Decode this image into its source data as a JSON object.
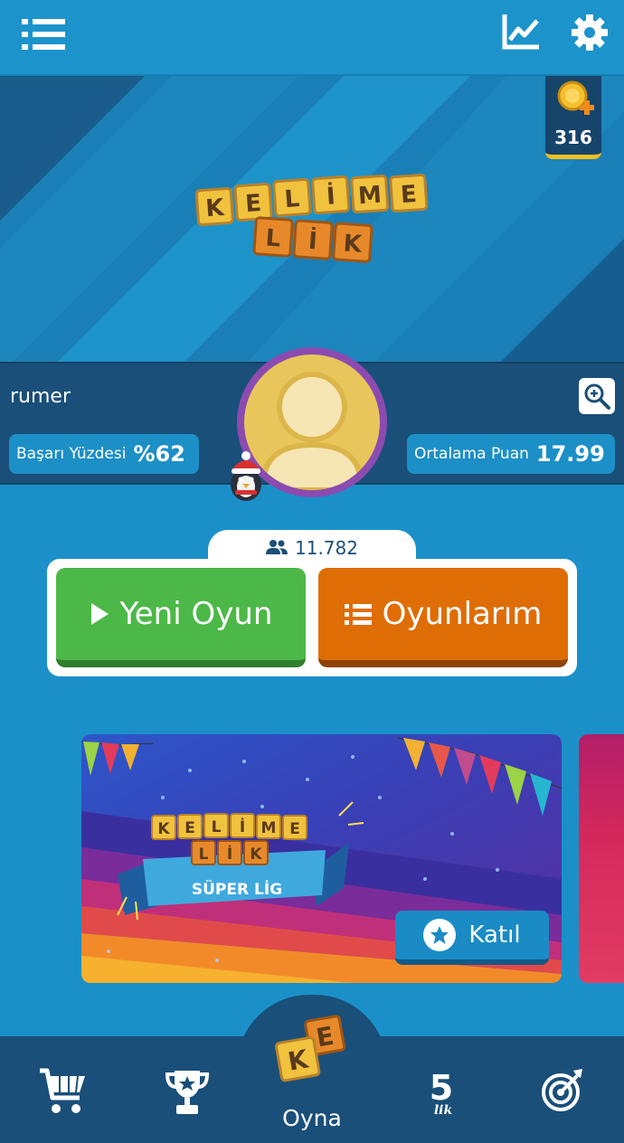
{
  "topbar": {
    "menu_icon": "menu-list-icon",
    "stats_icon": "line-chart-icon",
    "settings_icon": "gear-icon"
  },
  "hero": {
    "logo_line1": "KELİME",
    "logo_line2": "LİK",
    "coins": "316"
  },
  "profile": {
    "username": "rumer",
    "success_label": "Başarı Yüzdesi",
    "success_value": "%62",
    "avg_label": "Ortalama Puan",
    "avg_value": "17.99"
  },
  "online": {
    "count": "11.782"
  },
  "actions": {
    "new_game": "Yeni Oyun",
    "my_games": "Oyunlarım"
  },
  "banner": {
    "logo_line1": "KELİME",
    "logo_line2": "LİK",
    "ribbon": "SÜPER LİG",
    "join": "Katıl"
  },
  "nav": {
    "play_label": "Oyna"
  },
  "colors": {
    "primary_blue": "#1b90c8",
    "dark_navy": "#1a4f79",
    "green": "#4cb847",
    "orange": "#df6d06",
    "avatar_ring": "#8c4bb0",
    "tile_yellow": "#e9b53c"
  }
}
